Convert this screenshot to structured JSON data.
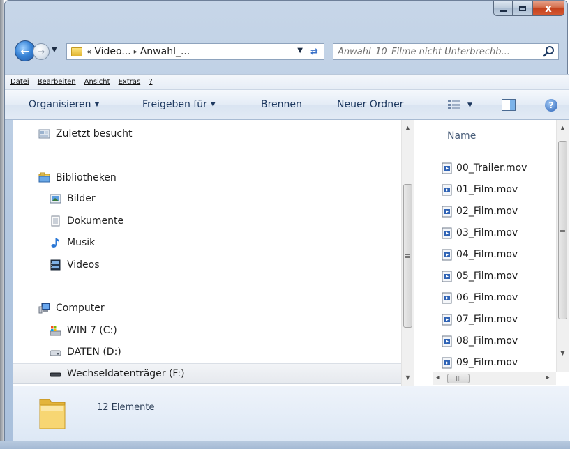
{
  "window": {
    "caption_buttons": {
      "close_glyph": "x"
    }
  },
  "navigation": {
    "back_glyph": "←",
    "forward_glyph": "→",
    "dropdown_glyph": "▼",
    "address": {
      "overflow_glyph": "«",
      "segments": [
        "Video...",
        "Anwahl_..."
      ],
      "separator_glyph": "▸",
      "dropdown_glyph": "▼",
      "refresh_glyph": "⇄"
    },
    "search": {
      "placeholder": "Anwahl_10_Filme nicht Unterbrechb...",
      "icon": "search-icon"
    }
  },
  "menu_bar": {
    "items": [
      "Datei",
      "Bearbeiten",
      "Ansicht",
      "Extras",
      "?"
    ]
  },
  "command_bar": {
    "organize": "Organisieren",
    "share": "Freigeben für",
    "burn": "Brennen",
    "new_folder": "Neuer Ordner",
    "dropdown_glyph": "▼",
    "help_glyph": "?"
  },
  "nav_pane": {
    "items": [
      {
        "label": "Zuletzt besucht",
        "icon": "recent-places-icon"
      },
      {
        "label": "Bibliotheken",
        "icon": "libraries-icon"
      },
      {
        "label": "Bilder",
        "icon": "pictures-icon"
      },
      {
        "label": "Dokumente",
        "icon": "documents-icon"
      },
      {
        "label": "Musik",
        "icon": "music-icon"
      },
      {
        "label": "Videos",
        "icon": "videos-icon"
      },
      {
        "label": "Computer",
        "icon": "computer-icon"
      },
      {
        "label": "WIN 7 (C:)",
        "icon": "system-drive-icon"
      },
      {
        "label": "DATEN (D:)",
        "icon": "hard-drive-icon"
      },
      {
        "label": "Wechseldatenträger (F:)",
        "icon": "removable-drive-icon",
        "selected": true
      }
    ],
    "scroll_up_glyph": "▲",
    "scroll_down_glyph": "▼",
    "thumb_grip": "≡"
  },
  "file_pane": {
    "column_header": "Name",
    "files": [
      "00_Trailer.mov",
      "01_Film.mov",
      "02_Film.mov",
      "03_Film.mov",
      "04_Film.mov",
      "05_Film.mov",
      "06_Film.mov",
      "07_Film.mov",
      "08_Film.mov",
      "09_Film.mov"
    ],
    "file_icon": "video-file-icon",
    "scroll_up_glyph": "▲",
    "scroll_down_glyph": "▼",
    "scroll_left_glyph": "◂",
    "scroll_right_glyph": "▸",
    "thumb_grip": "≡",
    "h_thumb_grip": "III"
  },
  "details": {
    "item_count": "12 Elemente",
    "icon": "folder-icon"
  },
  "colors": {
    "frame": "#b5c9e1",
    "close_button": "#c2401c",
    "command_text": "#1e3960",
    "selection": "#e6e9ee"
  }
}
